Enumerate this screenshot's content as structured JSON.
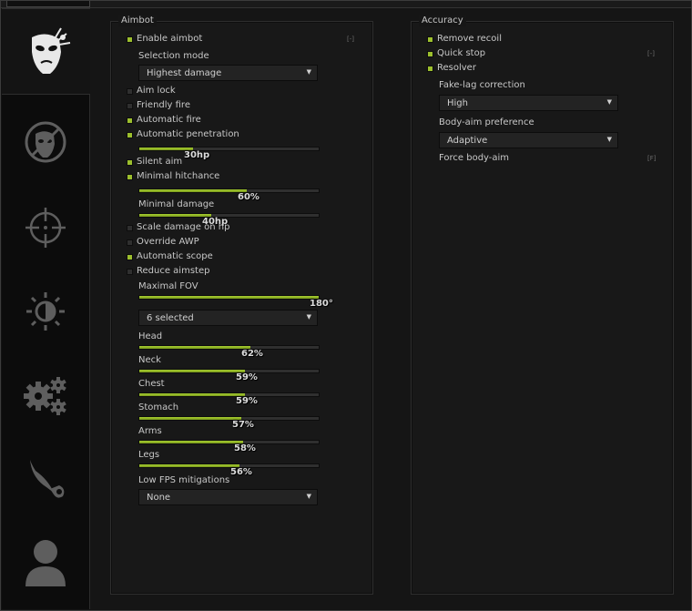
{
  "colors": {
    "accent": "#9cbf2d",
    "background": "#151515",
    "text": "#c8c8c8"
  },
  "sidebar": {
    "tabs": [
      {
        "name": "rage-tab",
        "icon": "rage-face-icon",
        "active": true
      },
      {
        "name": "legit-tab",
        "icon": "crossed-face-icon",
        "active": false
      },
      {
        "name": "visuals-tab",
        "icon": "crosshair-icon",
        "active": false
      },
      {
        "name": "misc-tab",
        "icon": "brightness-icon",
        "active": false
      },
      {
        "name": "settings-tab",
        "icon": "gears-icon",
        "active": false
      },
      {
        "name": "skins-tab",
        "icon": "karambit-icon",
        "active": false
      },
      {
        "name": "players-tab",
        "icon": "user-icon",
        "active": false
      }
    ]
  },
  "aimbot": {
    "title": "Aimbot",
    "enable": {
      "label": "Enable aimbot",
      "checked": true,
      "keybind": "[-]"
    },
    "selection_mode": {
      "label": "Selection mode",
      "value": "Highest damage"
    },
    "aim_lock": {
      "label": "Aim lock",
      "checked": false
    },
    "friendly_fire": {
      "label": "Friendly fire",
      "checked": false
    },
    "automatic_fire": {
      "label": "Automatic fire",
      "checked": true
    },
    "automatic_penetration": {
      "label": "Automatic penetration",
      "checked": true,
      "value_text": "30hp",
      "fraction": 0.3
    },
    "silent_aim": {
      "label": "Silent aim",
      "checked": true
    },
    "minimal_hitchance": {
      "label": "Minimal hitchance",
      "checked": true,
      "value_text": "60%",
      "fraction": 0.6
    },
    "minimal_damage": {
      "label": "Minimal damage",
      "value_text": "40hp",
      "fraction": 0.4
    },
    "scale_damage": {
      "label": "Scale damage on hp",
      "checked": false
    },
    "override_awp": {
      "label": "Override AWP",
      "checked": false
    },
    "automatic_scope": {
      "label": "Automatic scope",
      "checked": true
    },
    "reduce_aimstep": {
      "label": "Reduce aimstep",
      "checked": false
    },
    "maximal_fov": {
      "label": "Maximal FOV",
      "value_text": "180°",
      "fraction": 1.0
    },
    "hitboxes": {
      "value": "6 selected"
    },
    "scales": [
      {
        "label": "Head",
        "value_text": "62%",
        "fraction": 0.62
      },
      {
        "label": "Neck",
        "value_text": "59%",
        "fraction": 0.59
      },
      {
        "label": "Chest",
        "value_text": "59%",
        "fraction": 0.59
      },
      {
        "label": "Stomach",
        "value_text": "57%",
        "fraction": 0.57
      },
      {
        "label": "Arms",
        "value_text": "58%",
        "fraction": 0.58
      },
      {
        "label": "Legs",
        "value_text": "56%",
        "fraction": 0.56
      }
    ],
    "low_fps": {
      "label": "Low FPS mitigations",
      "value": "None"
    }
  },
  "accuracy": {
    "title": "Accuracy",
    "remove_recoil": {
      "label": "Remove recoil",
      "checked": true
    },
    "quick_stop": {
      "label": "Quick stop",
      "checked": true,
      "keybind": "[-]"
    },
    "resolver": {
      "label": "Resolver",
      "checked": true
    },
    "fake_lag": {
      "label": "Fake-lag correction",
      "value": "High"
    },
    "body_aim": {
      "label": "Body-aim preference",
      "value": "Adaptive"
    },
    "force_body_aim": {
      "label": "Force body-aim",
      "keybind": "[F]"
    }
  }
}
